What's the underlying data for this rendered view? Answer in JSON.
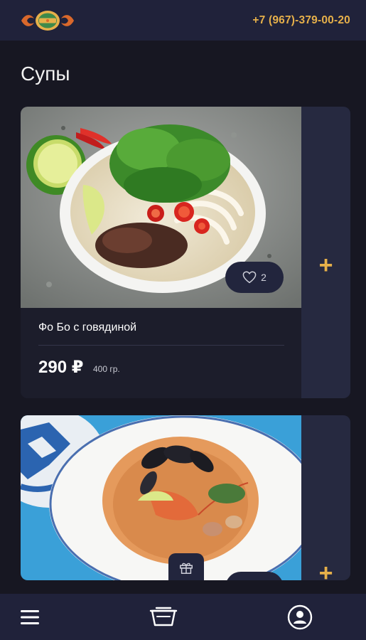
{
  "header": {
    "phone": "+7 (967)-379-00-20",
    "logo_icon": "restaurant-logo"
  },
  "section": {
    "title": "Супы"
  },
  "products": [
    {
      "name": "Фо Бо с говядиной",
      "price": "290 ₽",
      "weight": "400 гр.",
      "likes": "2",
      "add_label": "+"
    },
    {
      "add_label": "+"
    }
  ],
  "bottom_nav": {
    "menu_icon": "hamburger-menu-icon",
    "cart_icon": "basket-icon",
    "profile_icon": "user-profile-icon"
  },
  "colors": {
    "accent": "#e6b04a",
    "background": "#171722",
    "panel": "#20223a"
  }
}
